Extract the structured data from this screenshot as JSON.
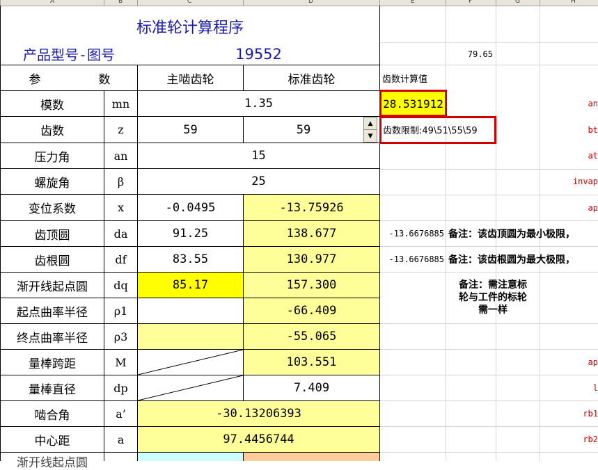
{
  "columns": [
    "A",
    "B",
    "C",
    "D",
    "E",
    "F",
    "G",
    "H"
  ],
  "title": "标准轮计算程序",
  "model_label": "产品型号-图号",
  "model_number": "19552",
  "f2_value": "79.65",
  "header": {
    "param": "参",
    "count": "数",
    "drive_gear": "主啮齿轮",
    "standard_gear": "标准齿轮",
    "tooth_calc": "齿数计算值"
  },
  "rows": [
    {
      "label": "模数",
      "symbol": "mn",
      "merged": "1.35"
    },
    {
      "label": "齿数",
      "symbol": "z",
      "c": "59",
      "d": "59"
    },
    {
      "label": "压力角",
      "symbol": "an",
      "merged": "15"
    },
    {
      "label": "螺旋角",
      "symbol": "β",
      "merged": "25"
    },
    {
      "label": "变位系数",
      "symbol": "x",
      "c": "-0.0495",
      "d": "-13.75926"
    },
    {
      "label": "齿顶圆",
      "symbol": "da",
      "c": "91.25",
      "d": "138.677"
    },
    {
      "label": "齿根圆",
      "symbol": "df",
      "c": "83.55",
      "d": "130.977"
    },
    {
      "label": "渐开线起点圆",
      "symbol": "dq",
      "c": "85.17",
      "d": "157.300"
    },
    {
      "label": "起点曲率半径",
      "symbol": "ρ1",
      "c": "",
      "d": "-66.409"
    },
    {
      "label": "终点曲率半径",
      "symbol": "ρ3",
      "c": "",
      "d": "-55.065"
    },
    {
      "label": "量棒跨距",
      "symbol": "M",
      "c": "",
      "d": "103.551"
    },
    {
      "label": "量棒直径",
      "symbol": "dp",
      "c": "",
      "d": "7.409"
    },
    {
      "label": "啮合角",
      "symbol": "a’",
      "merged": "-30.13206393"
    },
    {
      "label": "中心距",
      "symbol": "a",
      "merged": "97.4456744"
    }
  ],
  "tooth_calc_value": "28.531912",
  "tooth_limit": "齿数限制:49\\51\\55\\59",
  "e_values": {
    "row_da": "-13.6676885",
    "row_df": "-13.6676885"
  },
  "notes": {
    "da": "备注：该齿顶圆为最小极限，",
    "df": "备注：该齿根圆为最大极限，",
    "dq_line1": "备注：需注意标",
    "dq_line2": "轮与工件的标轮",
    "dq_line3": "需一样"
  },
  "right_labels": [
    "an",
    "bt",
    "at",
    "invap",
    "ap",
    "ap",
    "l",
    "rb1",
    "rb2"
  ],
  "partial_label": "渐开线起点圆",
  "colors": {
    "title": "#1a1aa8",
    "yellow": "#ffff00",
    "light_yellow": "#ffff99",
    "cyan": "#ccffff",
    "peach": "#ffcc99",
    "red": "#d40000"
  }
}
